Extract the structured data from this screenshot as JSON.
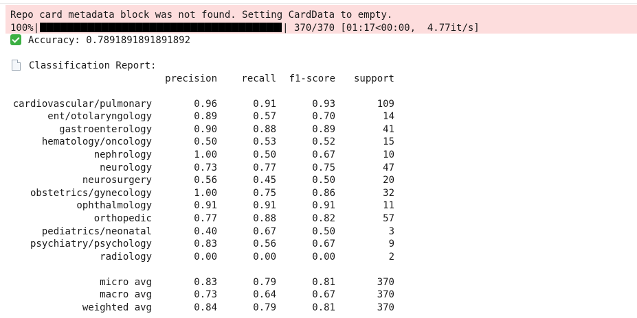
{
  "stderr": {
    "warning": "Repo card metadata block was not found. Setting CardData to empty.",
    "progress_prefix": "100%|",
    "progress_fraction": 1.0,
    "progress_suffix": "| 370/370 [01:17<00:00,  4.77it/s]"
  },
  "accuracy_line": "Accuracy: 0.7891891891891892",
  "report_title": "Classification Report:",
  "columns": [
    "precision",
    "recall",
    "f1-score",
    "support"
  ],
  "rows": [
    {
      "label": "cardiovascular/pulmonary",
      "precision": "0.96",
      "recall": "0.91",
      "f1": "0.93",
      "support": "109"
    },
    {
      "label": "ent/otolaryngology",
      "precision": "0.89",
      "recall": "0.57",
      "f1": "0.70",
      "support": "14"
    },
    {
      "label": "gastroenterology",
      "precision": "0.90",
      "recall": "0.88",
      "f1": "0.89",
      "support": "41"
    },
    {
      "label": "hematology/oncology",
      "precision": "0.50",
      "recall": "0.53",
      "f1": "0.52",
      "support": "15"
    },
    {
      "label": "nephrology",
      "precision": "1.00",
      "recall": "0.50",
      "f1": "0.67",
      "support": "10"
    },
    {
      "label": "neurology",
      "precision": "0.73",
      "recall": "0.77",
      "f1": "0.75",
      "support": "47"
    },
    {
      "label": "neurosurgery",
      "precision": "0.56",
      "recall": "0.45",
      "f1": "0.50",
      "support": "20"
    },
    {
      "label": "obstetrics/gynecology",
      "precision": "1.00",
      "recall": "0.75",
      "f1": "0.86",
      "support": "32"
    },
    {
      "label": "ophthalmology",
      "precision": "0.91",
      "recall": "0.91",
      "f1": "0.91",
      "support": "11"
    },
    {
      "label": "orthopedic",
      "precision": "0.77",
      "recall": "0.88",
      "f1": "0.82",
      "support": "57"
    },
    {
      "label": "pediatrics/neonatal",
      "precision": "0.40",
      "recall": "0.67",
      "f1": "0.50",
      "support": "3"
    },
    {
      "label": "psychiatry/psychology",
      "precision": "0.83",
      "recall": "0.56",
      "f1": "0.67",
      "support": "9"
    },
    {
      "label": "radiology",
      "precision": "0.00",
      "recall": "0.00",
      "f1": "0.00",
      "support": "2"
    }
  ],
  "averages": [
    {
      "label": "micro avg",
      "precision": "0.83",
      "recall": "0.79",
      "f1": "0.81",
      "support": "370"
    },
    {
      "label": "macro avg",
      "precision": "0.73",
      "recall": "0.64",
      "f1": "0.67",
      "support": "370"
    },
    {
      "label": "weighted avg",
      "precision": "0.84",
      "recall": "0.79",
      "f1": "0.81",
      "support": "370"
    }
  ],
  "icons": {
    "accuracy": "check-mark-icon",
    "report": "page-document-icon"
  },
  "colors": {
    "stderr_background": "#fddddd",
    "check_green": "#3cb043"
  }
}
